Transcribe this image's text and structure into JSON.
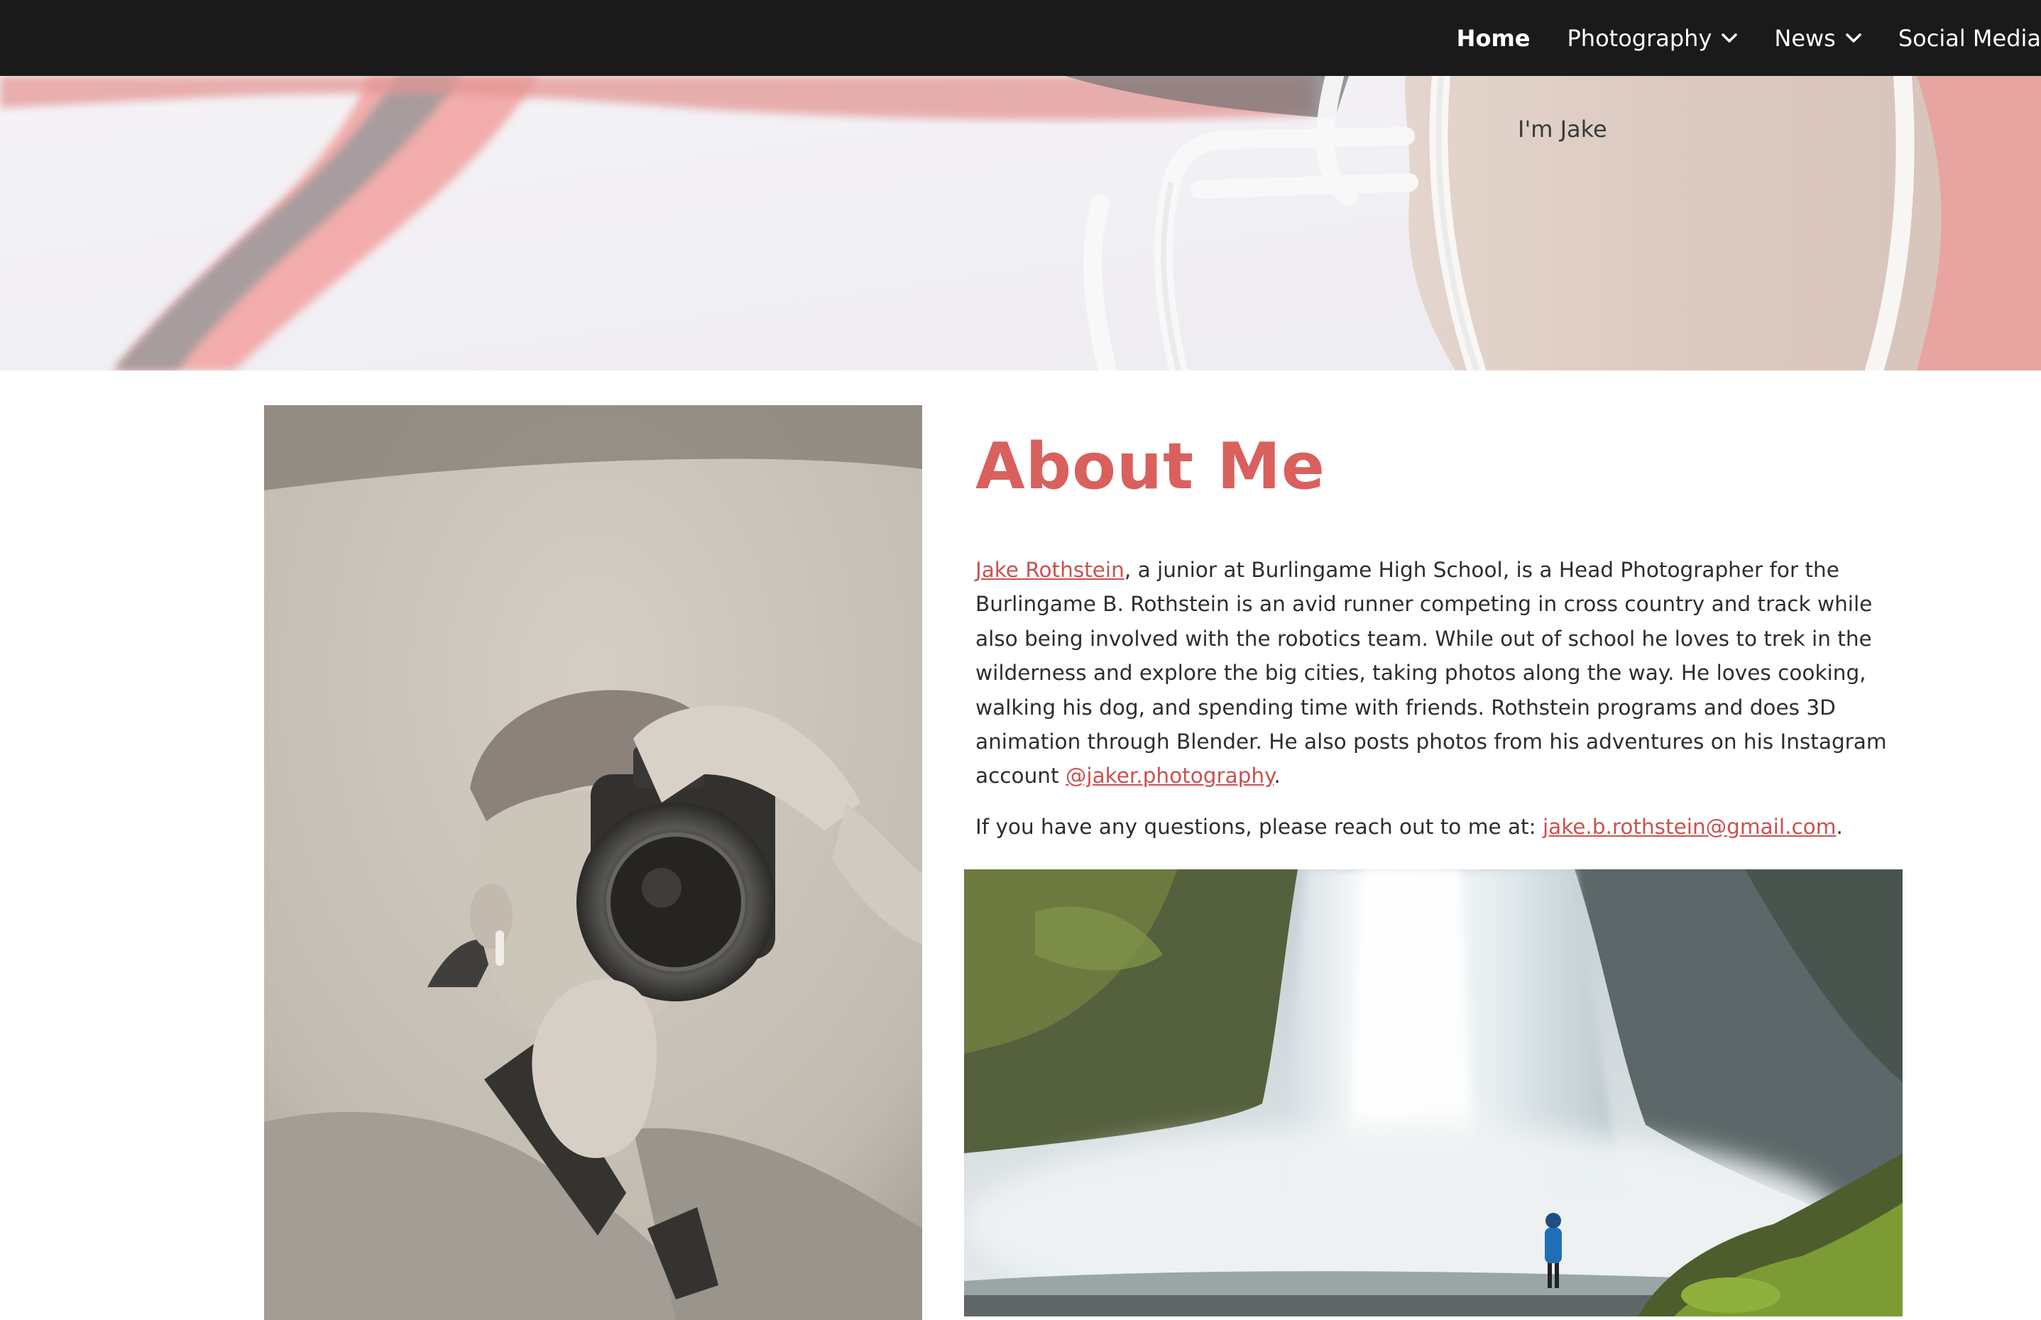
{
  "nav": {
    "items": [
      {
        "label": "Home",
        "active": true,
        "has_dropdown": false
      },
      {
        "label": "Photography",
        "active": false,
        "has_dropdown": true
      },
      {
        "label": "News",
        "active": false,
        "has_dropdown": true
      },
      {
        "label": "Social Media",
        "active": false,
        "has_dropdown": false
      }
    ]
  },
  "hero": {
    "tagline": "I'm Jake"
  },
  "about": {
    "title": "About Me",
    "name_link": "Jake Rothstein",
    "bio_text": ", a junior at Burlingame High School, is a Head Photographer for the Burlingame B. Rothstein is an avid runner competing in cross country and track while also being involved with the robotics team. While out of school he loves to trek in the wilderness and explore the big cities, taking photos along the way.  He loves cooking, walking his dog, and spending time with friends. Rothstein programs and does 3D animation through Blender. He also posts photos from his adventures on his Instagram account ",
    "instagram_link": "@jaker.photography",
    "bio_end": ".",
    "contact_prefix": "If you have any questions, please reach out to me at: ",
    "email_link": "jake.b.rothstein@gmail.com",
    "contact_end": "."
  },
  "colors": {
    "nav_bg": "#1a1a1a",
    "accent": "#d9605d",
    "link": "#c9524f",
    "body_text": "#2d2d2d"
  },
  "icons": {
    "dropdown": "chevron-down-icon"
  }
}
